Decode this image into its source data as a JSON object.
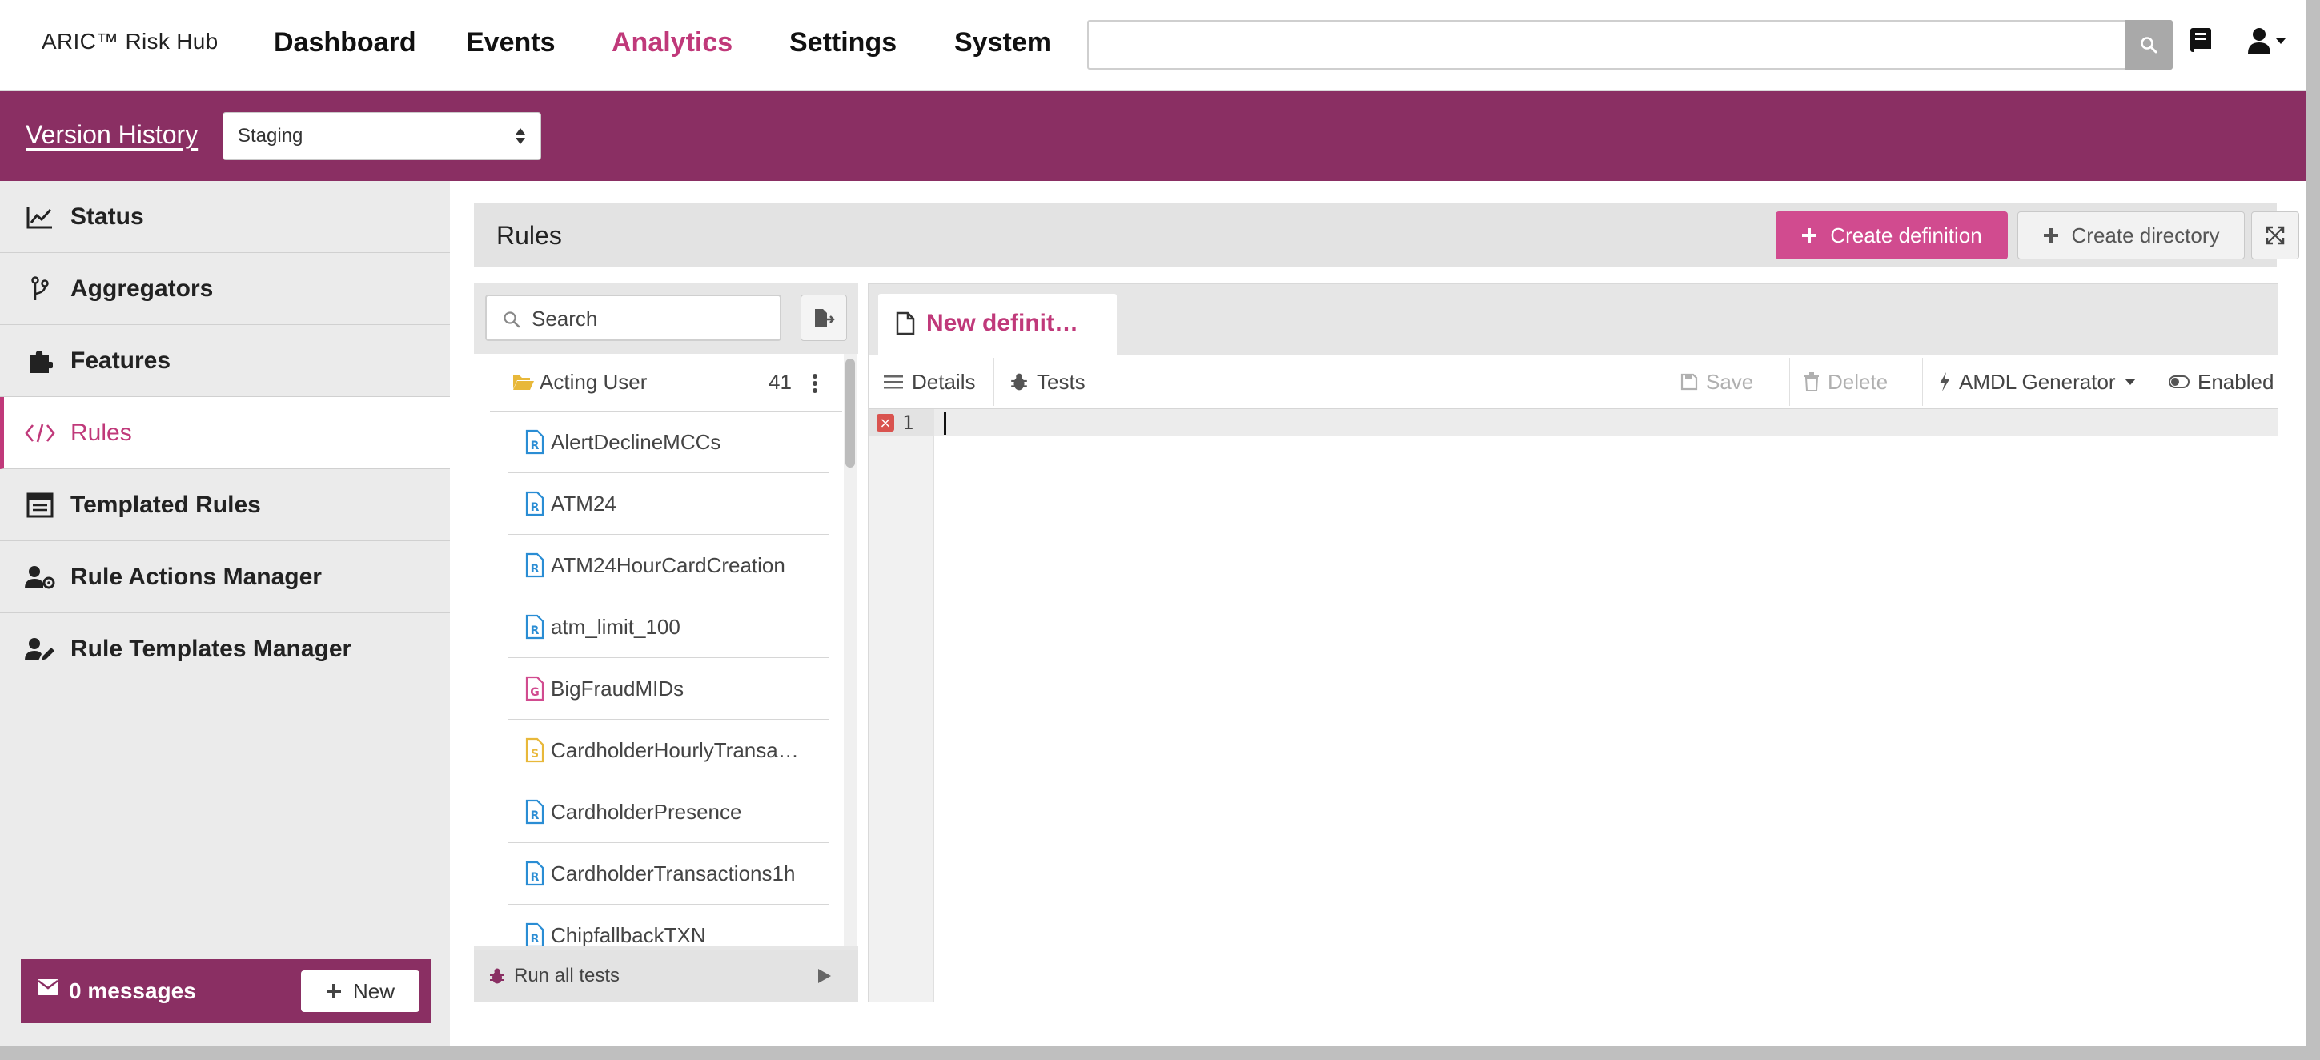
{
  "header": {
    "brand": "ARIC™ Risk Hub",
    "nav": [
      "Dashboard",
      "Events",
      "Analytics",
      "Settings",
      "System"
    ],
    "active_nav": "Analytics",
    "search_value": ""
  },
  "version_bar": {
    "link": "Version History",
    "environment": "Staging"
  },
  "sidebar": {
    "items": [
      {
        "label": "Status",
        "icon": "chart-line-icon"
      },
      {
        "label": "Aggregators",
        "icon": "branch-icon"
      },
      {
        "label": "Features",
        "icon": "puzzle-icon"
      },
      {
        "label": "Rules",
        "icon": "code-icon"
      },
      {
        "label": "Templated Rules",
        "icon": "template-icon"
      },
      {
        "label": "Rule Actions Manager",
        "icon": "user-gear-icon"
      },
      {
        "label": "Rule Templates Manager",
        "icon": "user-edit-icon"
      }
    ],
    "active": "Rules",
    "messages_label": "0 messages",
    "new_label": "New"
  },
  "rules_panel": {
    "title": "Rules",
    "create_definition": "Create definition",
    "create_directory": "Create directory"
  },
  "tree": {
    "search_placeholder": "Search",
    "folder": {
      "name": "Acting User",
      "count": "41"
    },
    "items": [
      {
        "name": "AlertDeclineMCCs",
        "type": "R",
        "color": "#2a8dd4"
      },
      {
        "name": "ATM24",
        "type": "R",
        "color": "#2a8dd4"
      },
      {
        "name": "ATM24HourCardCreation",
        "type": "R",
        "color": "#2a8dd4"
      },
      {
        "name": "atm_limit_100",
        "type": "R",
        "color": "#2a8dd4"
      },
      {
        "name": "BigFraudMIDs",
        "type": "G",
        "color": "#d14b8f"
      },
      {
        "name": "CardholderHourlyTransa…",
        "type": "S",
        "color": "#e8b83a"
      },
      {
        "name": "CardholderPresence",
        "type": "R",
        "color": "#2a8dd4"
      },
      {
        "name": "CardholderTransactions1h",
        "type": "R",
        "color": "#2a8dd4"
      },
      {
        "name": "ChipfallbackTXN",
        "type": "R",
        "color": "#2a8dd4"
      }
    ],
    "run_all_tests": "Run all tests"
  },
  "editor": {
    "tab_label": "New definit…",
    "toolbar": {
      "details": "Details",
      "tests": "Tests",
      "save": "Save",
      "delete": "Delete",
      "generator": "AMDL Generator",
      "enabled": "Enabled"
    },
    "line_number": "1",
    "error_mark": "×"
  },
  "colors": {
    "accent": "#c0397a",
    "brand_bar": "#8a2f63",
    "primary_button": "#d14b8f"
  }
}
